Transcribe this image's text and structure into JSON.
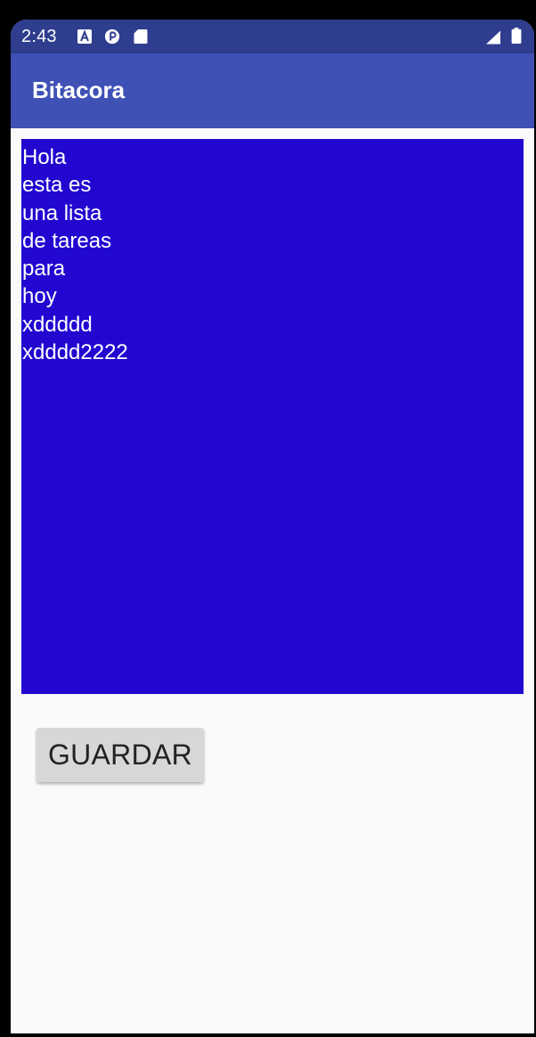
{
  "status_bar": {
    "time": "2:43",
    "icons": [
      "a-icon",
      "circle-p-icon",
      "sd-card-icon",
      "signal-icon",
      "battery-icon"
    ]
  },
  "app_bar": {
    "title": "Bitacora"
  },
  "notes": {
    "text": "Hola\nesta es\nuna lista\nde tareas\npara\nhoy\nxddddd\nxdddd2222",
    "background": "#2207d1"
  },
  "save_button": {
    "label": "GUARDAR"
  },
  "colors": {
    "status_bar": "#2f3d8f",
    "app_bar": "#3f51b5",
    "background": "#fafafa",
    "button": "#d6d7d7"
  }
}
